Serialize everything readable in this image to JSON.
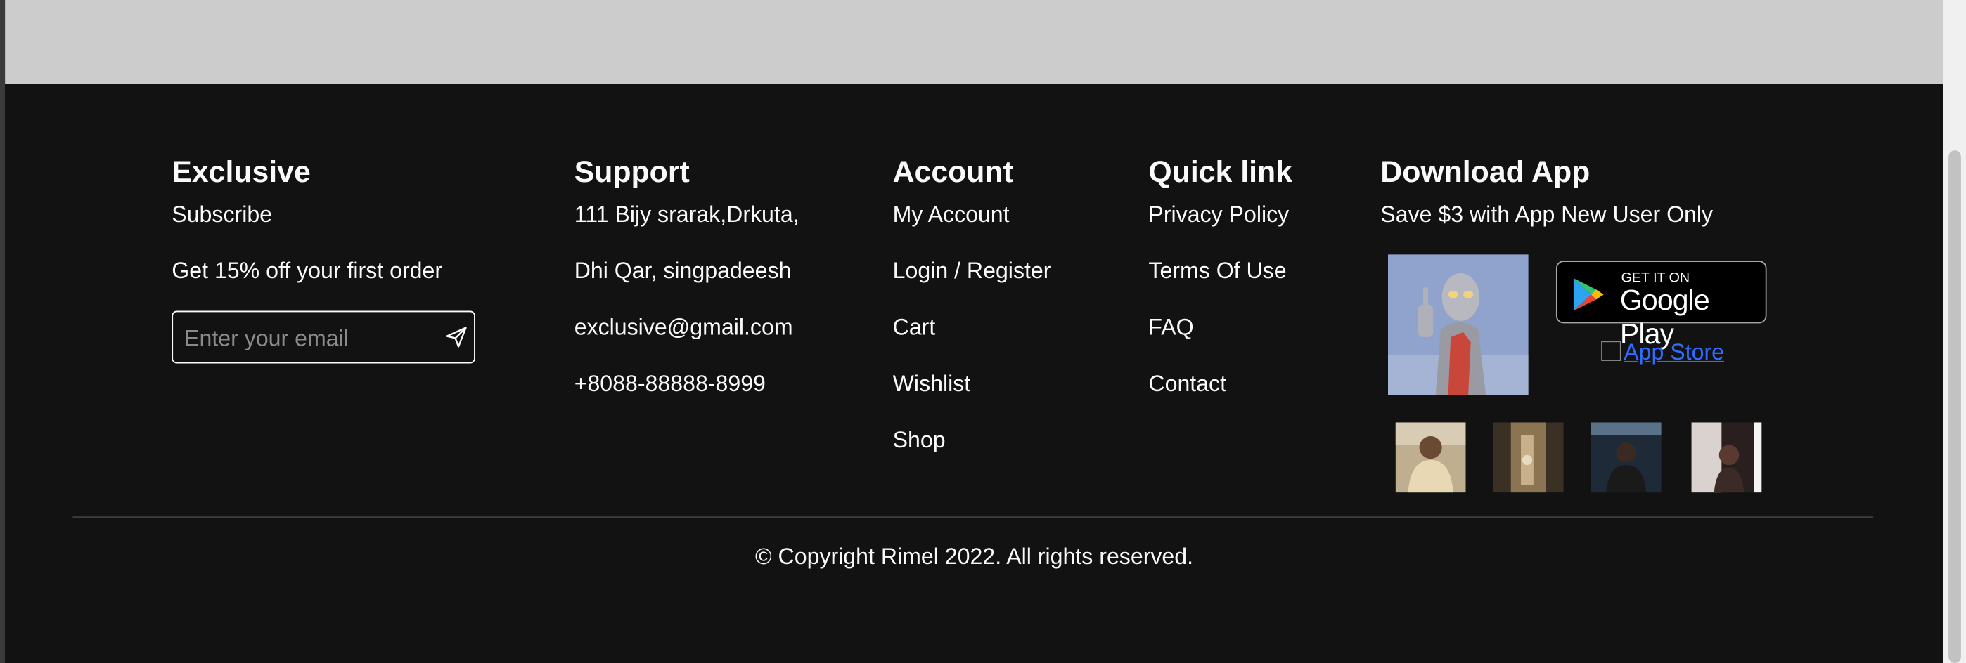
{
  "exclusive": {
    "heading": "Exclusive",
    "subscribe": "Subscribe",
    "offer": "Get 15% off your first order",
    "email_placeholder": "Enter your email"
  },
  "support": {
    "heading": "Support",
    "lines": [
      "111 Bijy srarak,Drkuta,",
      "Dhi Qar, singpadeesh",
      "exclusive@gmail.com",
      "+8088-88888-8999"
    ]
  },
  "account": {
    "heading": "Account",
    "links": [
      "My Account",
      "Login / Register",
      "Cart",
      "Wishlist",
      "Shop"
    ]
  },
  "quick_link": {
    "heading": "Quick link",
    "links": [
      "Privacy Policy",
      "Terms Of Use",
      "FAQ",
      "Contact"
    ]
  },
  "download": {
    "heading": "Download App",
    "promo": "Save $3 with App New User Only",
    "google_play_small": "GET IT ON",
    "google_play_big": "Google Play",
    "app_store_alt": "App Store"
  },
  "copyright": "© Copyright Rimel 2022. All rights reserved.",
  "colors": {
    "footer_bg": "#121212",
    "top_area_bg": "#cccccc",
    "text": "#fafafa",
    "link_blue": "#2f6bff"
  },
  "icons": [
    "send-icon",
    "google-play-logo-icon",
    "broken-image-icon"
  ]
}
